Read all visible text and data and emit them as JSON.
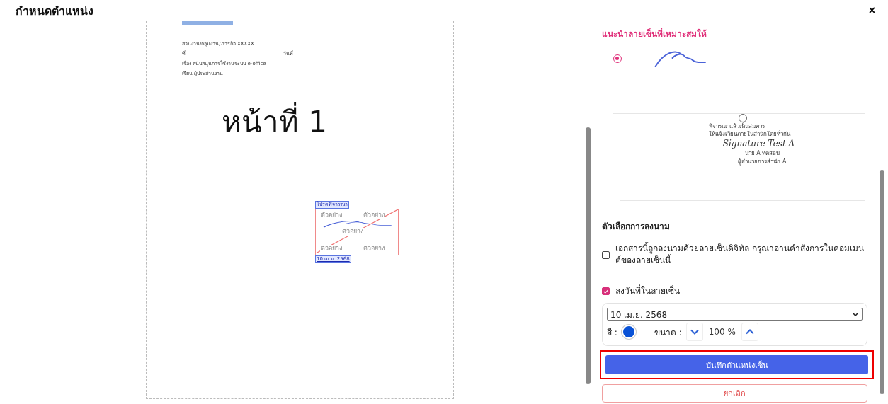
{
  "window": {
    "title": "กำหนดตำแหน่ง",
    "close": "×"
  },
  "document": {
    "header_lines": [
      {
        "kind": "text",
        "text": "ส่วนงาน/กลุ่มงาน/ภารกิจ XXXXX"
      },
      {
        "kind": "fields",
        "left": "ที่",
        "right": "วันที่"
      },
      {
        "kind": "text",
        "text": "เรื่อง สนับสนุนการใช้งานระบบ e-office"
      },
      {
        "kind": "text",
        "text": "เรียน ผู้ประสานงาน"
      }
    ],
    "page_label": "หน้าที่ 1",
    "placement": {
      "top_label": "โปรดพิจารณา",
      "watermarks": [
        "ตัวอย่าง",
        "ตัวอย่าง",
        "ตัวอย่าง",
        "ตัวอย่าง",
        "ตัวอย่าง"
      ],
      "date_label": "10 เม.ย. 2568"
    }
  },
  "panel": {
    "heading": "แนะนำลายเซ็นที่เหมาะสมให้",
    "signatures": [
      {
        "kind": "handwritten",
        "selected": true
      },
      {
        "kind": "stamp",
        "selected": false,
        "lines": [
          "พิจารณาแล้วเห็นสมควร",
          "ให้แจ้งเวียนภายในสำนักโดยทั่วกัน"
        ],
        "signature": "Signature Test A",
        "name": "นาย A ทดสอบ",
        "position": "ผู้อำนวยการสำนัก A"
      }
    ],
    "options_heading": "ตัวเลือกการลงนาม",
    "options": [
      {
        "label": "เอกสารนี้ถูกลงนามด้วยลายเซ็นดิจิทัล กรุณาอ่านคำสั่งการในคอมเมนต์ของลายเซ็นนี้",
        "checked": false
      },
      {
        "label": "ลงวันที่ในลายเซ็น",
        "checked": true
      }
    ],
    "date_format": {
      "value": "10 เม.ย. 2568",
      "color_label": "สี :",
      "color": "#0a52d6",
      "size_label": "ขนาด :",
      "size": "100 %"
    },
    "save_button": "บันทึกตำแหน่งเซ็น",
    "cancel_button": "ยกเลิก"
  }
}
